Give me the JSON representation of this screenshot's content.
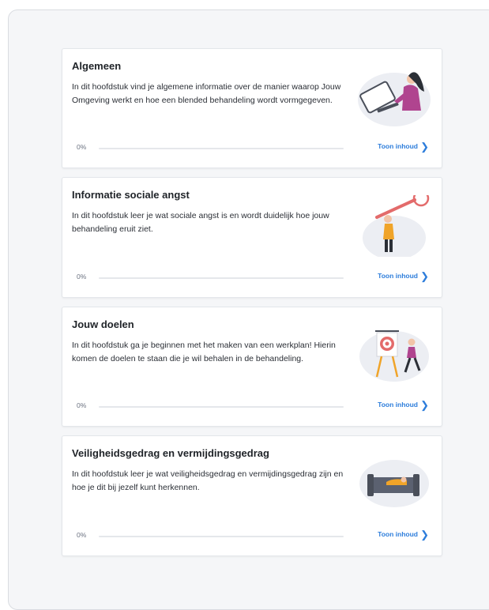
{
  "colors": {
    "accent": "#2d7ddb",
    "illustration": "#b0448f",
    "blob": "#eceef3"
  },
  "chapters": [
    {
      "title": "Algemeen",
      "description": "In dit hoofdstuk vind je algemene informatie over de manier waarop Jouw Omgeving werkt en hoe een blended behandeling wordt vormgegeven.",
      "progress_label": "0%",
      "progress": 0,
      "action_label": "Toon inhoud",
      "icon": "chevron-right-icon"
    },
    {
      "title": "Informatie sociale angst",
      "description": "In dit hoofdstuk leer je wat sociale angst is en wordt duidelijk hoe jouw behandeling eruit ziet.",
      "progress_label": "0%",
      "progress": 0,
      "action_label": "Toon inhoud",
      "icon": "chevron-right-icon"
    },
    {
      "title": "Jouw doelen",
      "description": "In dit hoofdstuk ga je beginnen met het maken van een werkplan! Hierin komen de doelen te staan die je wil behalen in de behandeling.",
      "progress_label": "0%",
      "progress": 0,
      "action_label": "Toon inhoud",
      "icon": "chevron-right-icon"
    },
    {
      "title": "Veiligheidsgedrag en vermijdingsgedrag",
      "description": "In dit hoofdstuk leer je wat veiligheidsgedrag en vermijdingsgedrag zijn en hoe je dit bij jezelf kunt herkennen.",
      "progress_label": "0%",
      "progress": 0,
      "action_label": "Toon inhoud",
      "icon": "chevron-right-icon"
    }
  ]
}
